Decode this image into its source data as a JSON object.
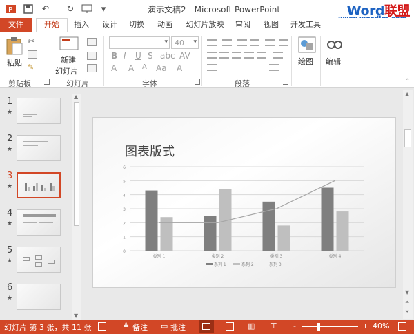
{
  "titlebar": {
    "title": "演示文稿2 - Microsoft PowerPoint",
    "qat": [
      "powerpoint-app-icon",
      "save-icon",
      "undo-icon",
      "redo-icon",
      "present-from-start-icon",
      "customize-qat-icon"
    ],
    "watermark_word": "Word",
    "watermark_cn": "联盟",
    "watermark_url": "www.wordlm.com"
  },
  "tabs": [
    "文件",
    "开始",
    "插入",
    "设计",
    "切换",
    "动画",
    "幻灯片放映",
    "审阅",
    "视图",
    "开发工具"
  ],
  "ribbon": {
    "paste_label": "粘贴",
    "new_slide_label_1": "新建",
    "new_slide_label_2": "幻灯片",
    "font_size": "40",
    "drawing_label": "绘图",
    "editing_label": "编辑",
    "groups": [
      "剪贴板",
      "幻灯片",
      "字体",
      "段落"
    ]
  },
  "slides": {
    "numbers": [
      "1",
      "2",
      "3",
      "4",
      "5",
      "6"
    ],
    "active_index": 3,
    "star": "★"
  },
  "slide": {
    "title": "图表版式"
  },
  "chart_data": {
    "type": "bar",
    "categories": [
      "类别 1",
      "类别 2",
      "类别 3",
      "类别 4"
    ],
    "series": [
      {
        "name": "系列 1",
        "type": "bar",
        "values": [
          4.3,
          2.5,
          3.5,
          4.5
        ],
        "color": "#7f7f7f"
      },
      {
        "name": "系列 2",
        "type": "bar",
        "values": [
          2.4,
          4.4,
          1.8,
          2.8
        ],
        "color": "#bfbfbf"
      },
      {
        "name": "系列 3",
        "type": "line",
        "values": [
          2,
          2,
          3,
          5
        ],
        "color": "#a6a6a6"
      }
    ],
    "yticks": [
      "0",
      "1",
      "2",
      "3",
      "4",
      "5",
      "6"
    ],
    "ylim": [
      0,
      6
    ],
    "grid": true,
    "legend": "bottom"
  },
  "status": {
    "slide_info": "幻灯片 第 3 张，共 11 张",
    "notes": "备注",
    "comments": "批注",
    "zoom": "40%",
    "zoom_minus": "-",
    "zoom_plus": "+"
  },
  "colors": {
    "accent": "#d24726",
    "watermark_blue": "#1c62c2",
    "watermark_red": "#d41919"
  }
}
